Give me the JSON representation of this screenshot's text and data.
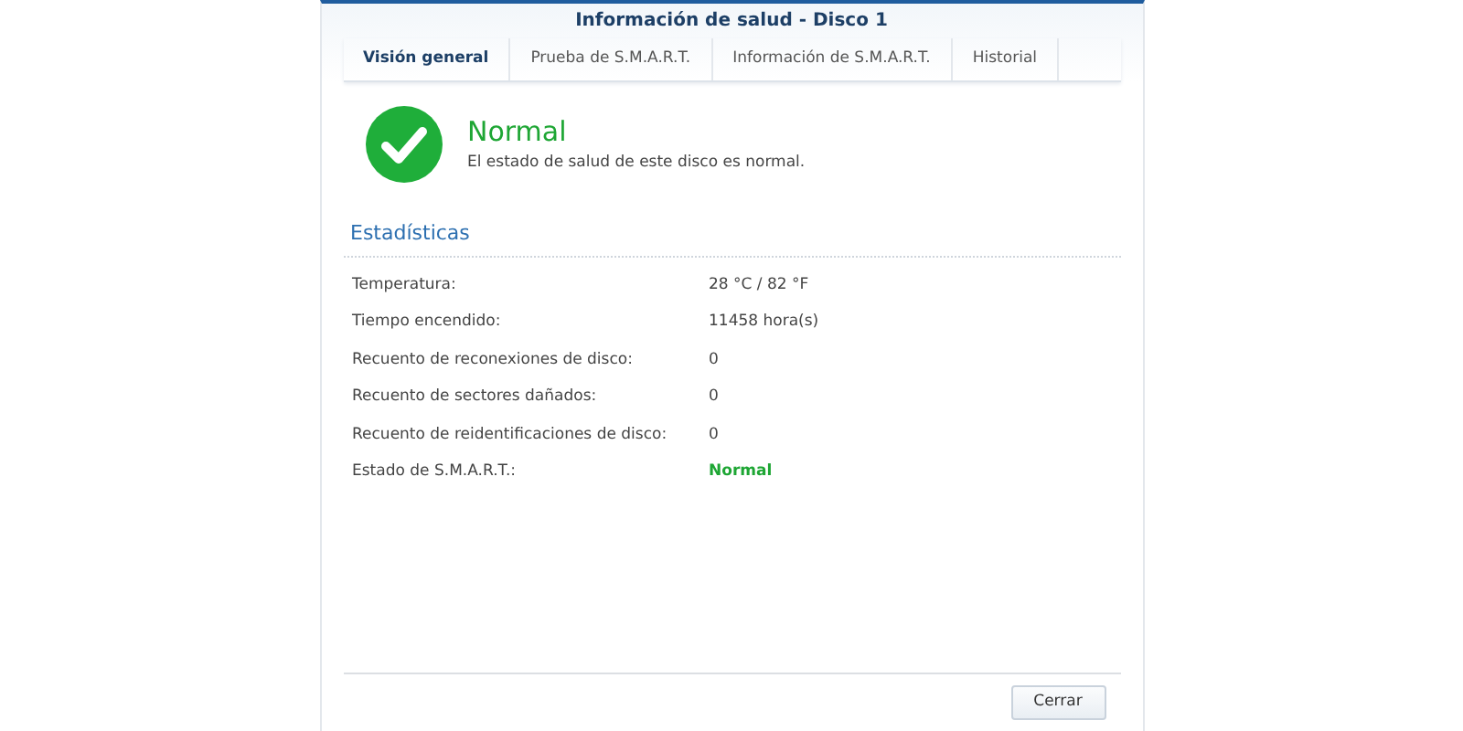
{
  "window": {
    "title": "Información de salud - Disco 1"
  },
  "tabs": [
    {
      "label": "Visión general",
      "selected": true
    },
    {
      "label": "Prueba de S.M.A.R.T.",
      "selected": false
    },
    {
      "label": "Información de S.M.A.R.T.",
      "selected": false
    },
    {
      "label": "Historial",
      "selected": false
    }
  ],
  "health": {
    "status": "Normal",
    "description": "El estado de salud de este disco es normal."
  },
  "statistics": {
    "title": "Estadísticas",
    "rows": [
      {
        "label": "Temperatura:",
        "value": "28 °C / 82 °F",
        "kind": "text"
      },
      {
        "label": "Tiempo encendido:",
        "value": "11458 hora(s)",
        "kind": "text"
      },
      {
        "label": "Recuento de reconexiones de disco:",
        "value": "0",
        "kind": "text"
      },
      {
        "label": "Recuento de sectores dañados:",
        "value": "0",
        "kind": "text"
      },
      {
        "label": "Recuento de reidentificaciones de disco:",
        "value": "0",
        "kind": "text"
      },
      {
        "label": "Estado de S.M.A.R.T.:",
        "value": "Normal",
        "kind": "status"
      }
    ]
  },
  "buttons": [
    "Cerrar"
  ]
}
